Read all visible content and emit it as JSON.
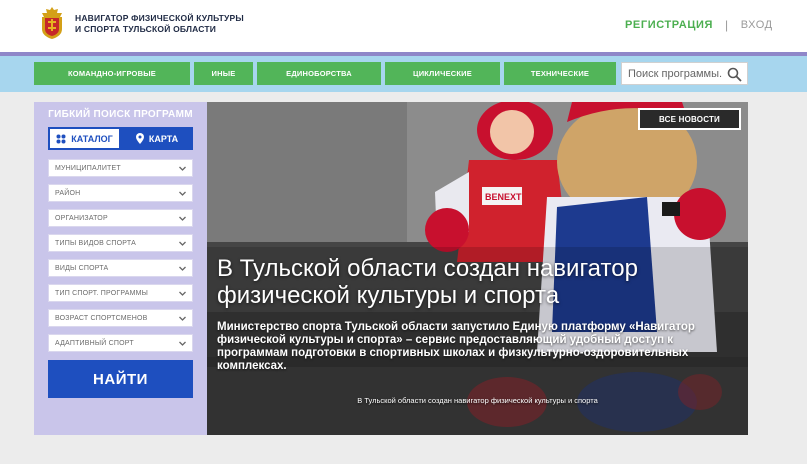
{
  "header": {
    "brand_line1": "НАВИГАТОР ФИЗИЧЕСКОЙ КУЛЬТУРЫ",
    "brand_line2": "И СПОРТА ТУЛЬСКОЙ ОБЛАСТИ",
    "register_label": "РЕГИСТРАЦИЯ",
    "separator": "|",
    "login_label": "ВХОД"
  },
  "nav": {
    "items": [
      {
        "label": "КОМАНДНО-ИГРОВЫЕ"
      },
      {
        "label": "ИНЫЕ"
      },
      {
        "label": "ЕДИНОБОРСТВА"
      },
      {
        "label": "ЦИКЛИЧЕСКИЕ"
      },
      {
        "label": "ТЕХНИЧЕСКИЕ"
      }
    ],
    "search_placeholder": "Поиск программы..."
  },
  "sidebar": {
    "title": "ГИБКИЙ ПОИСК ПРОГРАММ",
    "tab_catalog": "КАТАЛОГ",
    "tab_map": "КАРТА",
    "filters": [
      {
        "label": "МУНИЦИПАЛИТЕТ"
      },
      {
        "label": "РАЙОН"
      },
      {
        "label": "ОРГАНИЗАТОР"
      },
      {
        "label": "ТИПЫ ВИДОВ СПОРТА"
      },
      {
        "label": "ВИДЫ СПОРТА"
      },
      {
        "label": "ТИП СПОРТ. ПРОГРАММЫ"
      },
      {
        "label": "ВОЗРАСТ СПОРТСМЕНОВ"
      },
      {
        "label": "АДАПТИВНЫЙ СПОРТ"
      }
    ],
    "find_label": "НАЙТИ"
  },
  "hero": {
    "all_news_label": "ВСЕ НОВОСТИ",
    "title": "В Тульской области создан навигатор физической культуры и спорта",
    "description": "Министерство спорта Тульской области запустило Единую платформу «Навигатор физической культуры и спорта» – сервис предоставляющий удобный доступ к программам подготовки в спортивных школах и физкультурно-оздоровительных комплексах.",
    "caption": "В Тульской области создан навигатор физической культуры и спорта",
    "jacket_text": "BENEXT"
  },
  "colors": {
    "green": "#52b559",
    "blue": "#1e4fbf",
    "nav_bg": "#a7d6ee",
    "sidebar_bg": "#c9c5ea",
    "purple_line": "#8f87c9"
  },
  "icons": {
    "logo": "tula-coat-of-arms",
    "search": "search-icon",
    "catalog": "grid-icon",
    "map": "map-pin-icon",
    "dropdown": "chevron-down-icon"
  }
}
